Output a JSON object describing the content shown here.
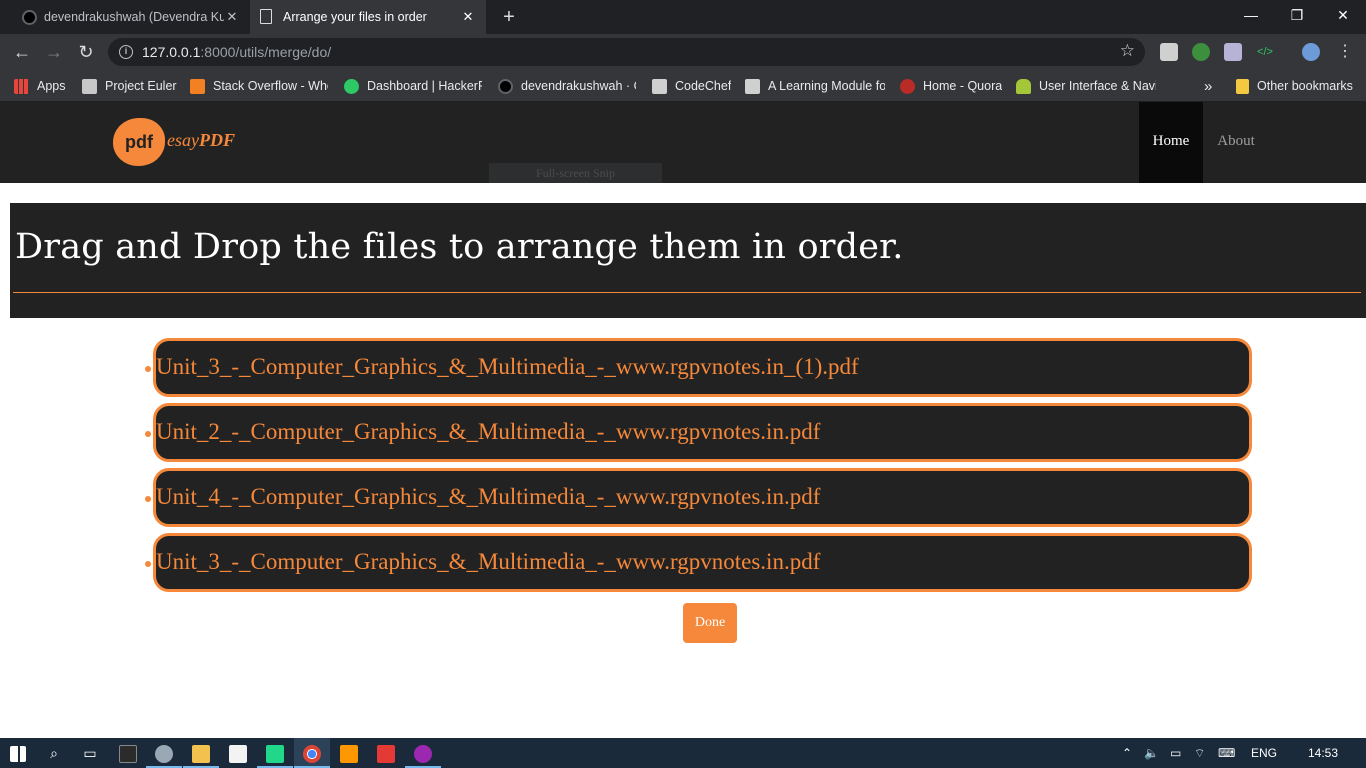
{
  "browser": {
    "tabs": [
      {
        "title": "devendrakushwah (Devendra Kus",
        "active": false,
        "icon": "github-icon"
      },
      {
        "title": "Arrange your files in order",
        "active": true,
        "icon": "document-icon"
      }
    ],
    "url_host": "127.0.0.1",
    "url_rest": ":8000/utils/merge/do/",
    "bookmarks": [
      {
        "label": "Apps",
        "icon": "apps-grid-icon",
        "color": "#e8453c"
      },
      {
        "label": "Project Euler",
        "icon": "project-euler-icon",
        "color": "#c8c8c8"
      },
      {
        "label": "Stack Overflow - Whe",
        "icon": "stackoverflow-icon",
        "color": "#f48024"
      },
      {
        "label": "Dashboard | HackerR",
        "icon": "hackerrank-icon",
        "color": "#2ec866"
      },
      {
        "label": "devendrakushwah · G",
        "icon": "github-icon",
        "color": "#000000"
      },
      {
        "label": "CodeChef",
        "icon": "codechef-icon",
        "color": "#d0d0d0"
      },
      {
        "label": "A Learning Module fo",
        "icon": "codechef-icon",
        "color": "#d0d0d0"
      },
      {
        "label": "Home - Quora",
        "icon": "quora-icon",
        "color": "#b92b27"
      },
      {
        "label": "User Interface & Navi",
        "icon": "android-icon",
        "color": "#a4c639"
      }
    ],
    "bookmarks_overflow": "»",
    "other_bookmarks": "Other bookmarks"
  },
  "site": {
    "logo_badge": "pdf",
    "logo_text_light": "esay",
    "logo_text_bold": "PDF",
    "nav": [
      {
        "label": "Home",
        "active": true
      },
      {
        "label": "About",
        "active": false
      }
    ],
    "snip_overlay": "Full-screen Snip"
  },
  "page": {
    "heading": "Drag and Drop the files to arrange them in order.",
    "files": [
      "Unit_3_-_Computer_Graphics_&_Multimedia_-_www.rgpvnotes.in_(1).pdf",
      "Unit_2_-_Computer_Graphics_&_Multimedia_-_www.rgpvnotes.in.pdf",
      "Unit_4_-_Computer_Graphics_&_Multimedia_-_www.rgpvnotes.in.pdf",
      "Unit_3_-_Computer_Graphics_&_Multimedia_-_www.rgpvnotes.in.pdf"
    ],
    "done_label": "Done",
    "accent_color": "#f5883a",
    "dark_color": "#222222"
  },
  "taskbar": {
    "language": "ENG",
    "time": "14:53"
  }
}
